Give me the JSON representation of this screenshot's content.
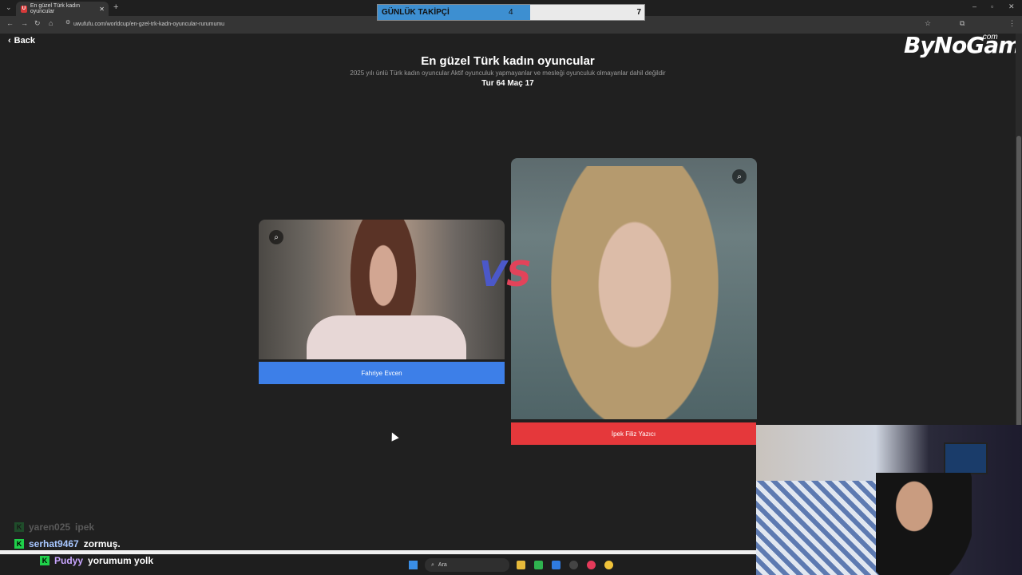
{
  "browser": {
    "tab_title": "En güzel Türk kadın oyuncular",
    "tab_favicon_letter": "U",
    "url": "uwufufu.com/worldcup/en-gzel-trk-kadn-oyuncular-rurumumu"
  },
  "overlay": {
    "followers_label": "GÜNLÜK TAKİPÇİ",
    "followers_count": "4",
    "followers_goal": "7",
    "followers_fraction": 0.571,
    "logo": "ByNoGame",
    "logo_suffix": ".com"
  },
  "page": {
    "back_label": "Back",
    "title": "En güzel Türk kadın oyuncular",
    "subtitle": "2025 yılı ünlü Türk kadın oyuncular Aktif oyunculuk yapmayanlar ve mesleği oyunculuk olmayanlar dahil değildir",
    "round": "Tur 64 Maç 17",
    "vs_v": "V",
    "vs_s": "S"
  },
  "contestants": {
    "left_name": "Fahriye Evcen",
    "right_name": "İpek Filiz Yazıcı"
  },
  "chat": [
    {
      "user": "yaren025",
      "text": "ipek"
    },
    {
      "user": "serhat9467",
      "text": "zormuş."
    },
    {
      "user": "Pudyy",
      "text": "yorumum yolk"
    }
  ],
  "taskbar": {
    "search_placeholder": "Ara"
  },
  "colors": {
    "left_button": "#3d7fe8",
    "right_button": "#e5383b",
    "followers_fill": "#3d8fd1"
  }
}
